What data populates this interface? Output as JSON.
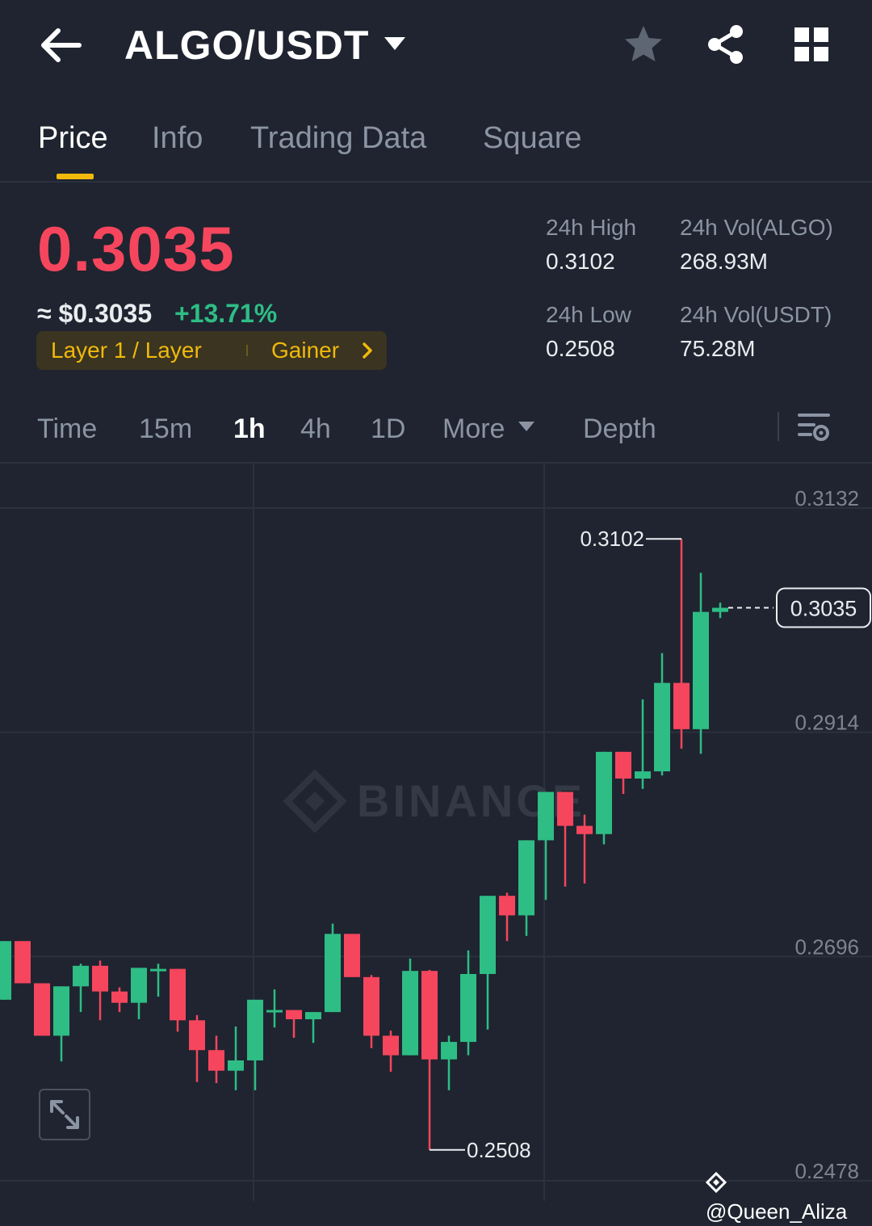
{
  "header": {
    "title": "ALGO/USDT",
    "icons": [
      "back-arrow-icon",
      "caret-down-icon",
      "star-icon",
      "share-icon",
      "grid-icon"
    ]
  },
  "tabs": [
    {
      "label": "Price",
      "active": true
    },
    {
      "label": "Info",
      "active": false
    },
    {
      "label": "Trading Data",
      "active": false
    },
    {
      "label": "Square",
      "active": false
    }
  ],
  "ticker": {
    "last_price": "0.3035",
    "usd_price": "≈ $0.3035",
    "change_pct": "+13.71%",
    "tag_category": "Layer 1 / Layer",
    "tag_status": "Gainer",
    "stats": {
      "high_label": "24h High",
      "high_value": "0.3102",
      "low_label": "24h Low",
      "low_value": "0.2508",
      "vol_base_label": "24h Vol(ALGO)",
      "vol_base_value": "268.93M",
      "vol_quote_label": "24h Vol(USDT)",
      "vol_quote_value": "75.28M"
    }
  },
  "intervals": [
    {
      "label": "Time",
      "active": false
    },
    {
      "label": "15m",
      "active": false
    },
    {
      "label": "1h",
      "active": true
    },
    {
      "label": "4h",
      "active": false
    },
    {
      "label": "1D",
      "active": false
    },
    {
      "label": "More",
      "active": false
    },
    {
      "label": "Depth",
      "active": false
    }
  ],
  "colors": {
    "up": "#2ebd85",
    "down": "#f6465d",
    "accent": "#f0b90b",
    "bg": "#1f2430"
  },
  "watermark": "@Queen_Aliza",
  "chart_data": {
    "type": "candlestick",
    "y_ticks": [
      0.3132,
      0.2914,
      0.2696,
      0.2478
    ],
    "ylim": [
      0.2478,
      0.3132
    ],
    "grid": true,
    "watermark": "BINANCE",
    "high_marker": "0.3102",
    "low_marker": "0.2508",
    "last_price_label": "0.3035",
    "candles": [
      {
        "o": 0.2654,
        "h": 0.2638,
        "l": 0.2706,
        "c": 0.2711
      },
      {
        "o": 0.2711,
        "h": 0.2654,
        "l": 0.2726,
        "c": 0.267
      },
      {
        "o": 0.267,
        "h": 0.2666,
        "l": 0.2626,
        "c": 0.2619
      },
      {
        "o": 0.2619,
        "h": 0.2667,
        "l": 0.2594,
        "c": 0.2667
      },
      {
        "o": 0.2667,
        "h": 0.2689,
        "l": 0.2642,
        "c": 0.2687
      },
      {
        "o": 0.2687,
        "h": 0.2692,
        "l": 0.2634,
        "c": 0.2662
      },
      {
        "o": 0.2662,
        "h": 0.2666,
        "l": 0.2642,
        "c": 0.2651
      },
      {
        "o": 0.2651,
        "h": 0.2684,
        "l": 0.2635,
        "c": 0.2685
      },
      {
        "o": 0.2684,
        "h": 0.2689,
        "l": 0.2657,
        "c": 0.2684
      },
      {
        "o": 0.2684,
        "h": 0.2679,
        "l": 0.2623,
        "c": 0.2634
      },
      {
        "o": 0.2634,
        "h": 0.2639,
        "l": 0.2574,
        "c": 0.2605
      },
      {
        "o": 0.2605,
        "h": 0.2619,
        "l": 0.2573,
        "c": 0.2585
      },
      {
        "o": 0.2585,
        "h": 0.2628,
        "l": 0.2566,
        "c": 0.2595
      },
      {
        "o": 0.2595,
        "h": 0.2644,
        "l": 0.2566,
        "c": 0.2654
      },
      {
        "o": 0.2644,
        "h": 0.2664,
        "l": 0.2627,
        "c": 0.2644
      },
      {
        "o": 0.2644,
        "h": 0.263,
        "l": 0.2617,
        "c": 0.2635
      },
      {
        "o": 0.2635,
        "h": 0.2637,
        "l": 0.2612,
        "c": 0.2642
      },
      {
        "o": 0.2642,
        "h": 0.2728,
        "l": 0.2642,
        "c": 0.2718
      },
      {
        "o": 0.2718,
        "h": 0.2717,
        "l": 0.2689,
        "c": 0.2676
      },
      {
        "o": 0.2676,
        "h": 0.2678,
        "l": 0.2607,
        "c": 0.2619
      },
      {
        "o": 0.2619,
        "h": 0.2624,
        "l": 0.2584,
        "c": 0.26
      },
      {
        "o": 0.26,
        "h": 0.2694,
        "l": 0.2605,
        "c": 0.2682
      },
      {
        "o": 0.2682,
        "h": 0.2683,
        "l": 0.2508,
        "c": 0.2596
      },
      {
        "o": 0.2596,
        "h": 0.2619,
        "l": 0.2566,
        "c": 0.2613
      },
      {
        "o": 0.2613,
        "h": 0.2702,
        "l": 0.26,
        "c": 0.2679
      },
      {
        "o": 0.2679,
        "h": 0.2718,
        "l": 0.2625,
        "c": 0.2755
      },
      {
        "o": 0.2755,
        "h": 0.2758,
        "l": 0.2711,
        "c": 0.2736
      },
      {
        "o": 0.2736,
        "h": 0.2791,
        "l": 0.2716,
        "c": 0.2809
      },
      {
        "o": 0.2809,
        "h": 0.2853,
        "l": 0.2751,
        "c": 0.2856
      },
      {
        "o": 0.2856,
        "h": 0.2789,
        "l": 0.2764,
        "c": 0.2823
      },
      {
        "o": 0.2823,
        "h": 0.2834,
        "l": 0.2767,
        "c": 0.2815
      },
      {
        "o": 0.2815,
        "h": 0.2886,
        "l": 0.2805,
        "c": 0.2895
      },
      {
        "o": 0.2895,
        "h": 0.2893,
        "l": 0.2854,
        "c": 0.2869
      },
      {
        "o": 0.2869,
        "h": 0.2946,
        "l": 0.2859,
        "c": 0.2876
      },
      {
        "o": 0.2876,
        "h": 0.2991,
        "l": 0.2872,
        "c": 0.2962
      },
      {
        "o": 0.2962,
        "h": 0.3102,
        "l": 0.2898,
        "c": 0.2917
      },
      {
        "o": 0.2917,
        "h": 0.3069,
        "l": 0.2893,
        "c": 0.3031
      },
      {
        "o": 0.3031,
        "h": 0.304,
        "l": 0.3025,
        "c": 0.3035
      }
    ]
  }
}
